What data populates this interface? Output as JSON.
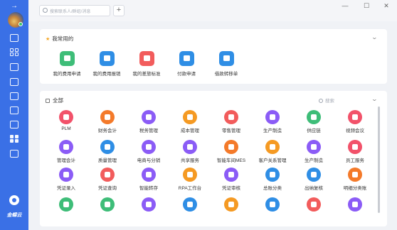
{
  "topbar": {
    "search_placeholder": "搜索联系人/群组/消息",
    "add_label": "+",
    "min_label": "—",
    "max_label": "☐",
    "close_label": "✕"
  },
  "sidebar": {
    "collapse_label": "→",
    "logo_text": "金蝶云"
  },
  "favorites": {
    "title": "我常用的",
    "items": [
      {
        "label": "我的费用申请",
        "color": "#3ebd78"
      },
      {
        "label": "我的费用报销",
        "color": "#2f8ee5"
      },
      {
        "label": "我的差旅标准",
        "color": "#f25c5c"
      },
      {
        "label": "付款申请",
        "color": "#2f8ee5"
      },
      {
        "label": "借款转移单",
        "color": "#2f8ee5"
      }
    ]
  },
  "all": {
    "title": "全部",
    "search_placeholder": "搜索",
    "rows": [
      [
        {
          "label": "PLM",
          "color": "#f2526a"
        },
        {
          "label": "财务会计",
          "color": "#f47a2a"
        },
        {
          "label": "税务管理",
          "color": "#8b5cf6"
        },
        {
          "label": "成本管理",
          "color": "#f59a23"
        },
        {
          "label": "零售管理",
          "color": "#f25c5c"
        },
        {
          "label": "生产制造",
          "color": "#8b5cf6"
        },
        {
          "label": "供应链",
          "color": "#3ebd78"
        },
        {
          "label": "视频会议",
          "color": "#f2526a"
        }
      ],
      [
        {
          "label": "管理会计",
          "color": "#8b5cf6"
        },
        {
          "label": "质量管理",
          "color": "#2f8ee5"
        },
        {
          "label": "电商与分销",
          "color": "#8b5cf6"
        },
        {
          "label": "共享服务",
          "color": "#8b5cf6"
        },
        {
          "label": "智能车间MES",
          "color": "#f47a2a"
        },
        {
          "label": "客户关系管理",
          "color": "#f59a23"
        },
        {
          "label": "生产制造",
          "color": "#8b5cf6"
        },
        {
          "label": "员工服务",
          "color": "#f2526a"
        }
      ],
      [
        {
          "label": "凭证录入",
          "color": "#8b5cf6"
        },
        {
          "label": "凭证查询",
          "color": "#f25c5c"
        },
        {
          "label": "智能转存",
          "color": "#8b5cf6"
        },
        {
          "label": "RPA工作台",
          "color": "#f59a23"
        },
        {
          "label": "凭证审核",
          "color": "#8b5cf6"
        },
        {
          "label": "总账分类",
          "color": "#2f8ee5"
        },
        {
          "label": "出纳复核",
          "color": "#2f8ee5"
        },
        {
          "label": "明细分类账",
          "color": "#f47a2a"
        }
      ],
      [
        {
          "label": "",
          "color": "#3ebd78"
        },
        {
          "label": "",
          "color": "#3ebd78"
        },
        {
          "label": "",
          "color": "#8b5cf6"
        },
        {
          "label": "",
          "color": "#2f8ee5"
        },
        {
          "label": "",
          "color": "#f59a23"
        },
        {
          "label": "",
          "color": "#2f8ee5"
        },
        {
          "label": "",
          "color": "#f25c5c"
        },
        {
          "label": "",
          "color": "#8b5cf6"
        }
      ]
    ]
  }
}
